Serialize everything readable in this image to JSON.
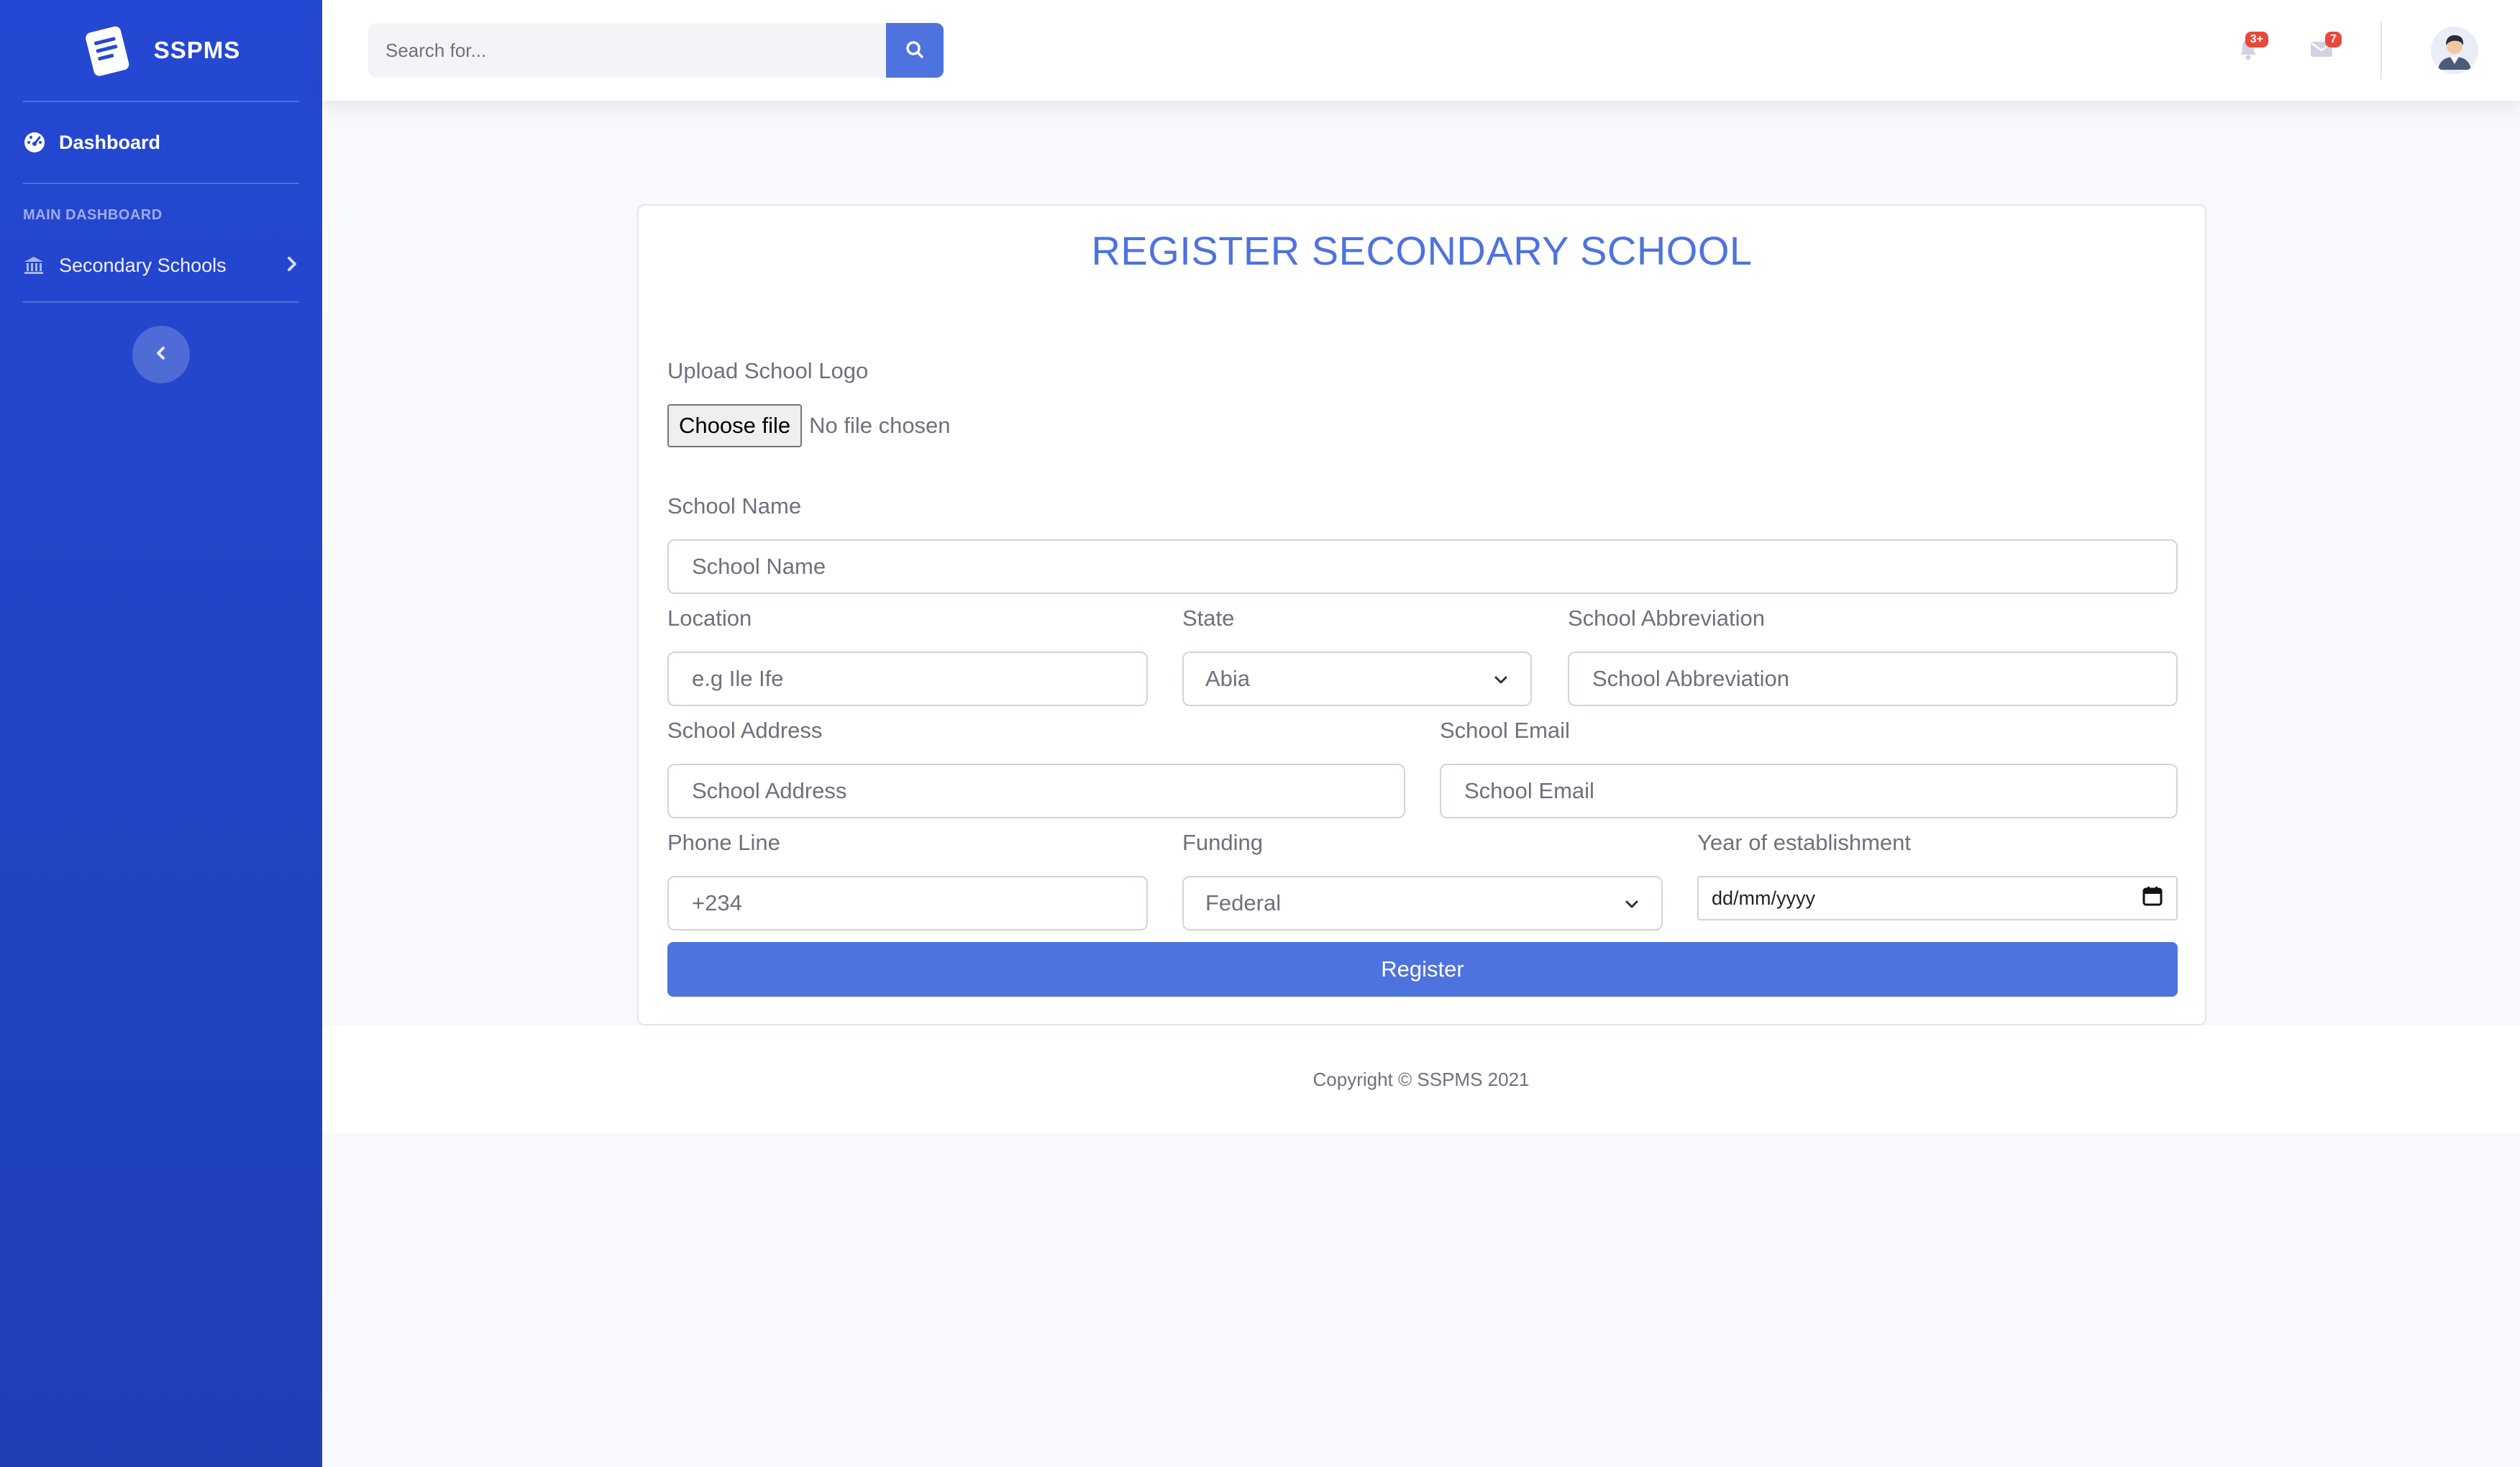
{
  "brand": {
    "name": "SSPMS",
    "icon": "document-logo-icon"
  },
  "sidebar": {
    "dashboard_label": "Dashboard",
    "section_heading": "MAIN DASHBOARD",
    "items": [
      {
        "label": "Secondary Schools",
        "icon": "university-icon"
      }
    ]
  },
  "topbar": {
    "search_placeholder": "Search for...",
    "alerts_badge": "3+",
    "messages_badge": "7"
  },
  "form": {
    "title": "REGISTER SECONDARY SCHOOL",
    "logo_label": "Upload School Logo",
    "file_button": "Choose file",
    "file_status": "No file chosen",
    "school_name_label": "School Name",
    "school_name_placeholder": "School Name",
    "location_label": "Location",
    "location_placeholder": "e.g Ile Ife",
    "state_label": "State",
    "state_value": "Abia",
    "abbreviation_label": "School Abbreviation",
    "abbreviation_placeholder": "School Abbreviation",
    "address_label": "School Address",
    "address_placeholder": "School Address",
    "email_label": "School Email",
    "email_placeholder": "School Email",
    "phone_label": "Phone Line",
    "phone_placeholder": "+234",
    "funding_label": "Funding",
    "funding_value": "Federal",
    "year_label": "Year of establishment",
    "year_placeholder": "dd/mm/yyyy",
    "submit_label": "Register"
  },
  "footer": {
    "copyright": "Copyright © SSPMS 2021"
  },
  "colors": {
    "primary": "#4e73df",
    "sidebar": "#2548d4",
    "badge": "#e74a3b"
  }
}
